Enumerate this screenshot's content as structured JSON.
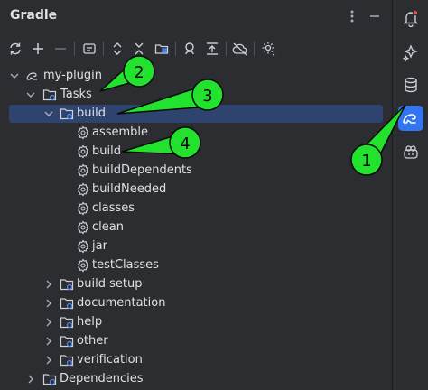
{
  "panel": {
    "title": "Gradle"
  },
  "tree": {
    "root": "my-plugin",
    "tasks": "Tasks",
    "build_group": "build",
    "build_tasks": [
      "assemble",
      "build",
      "buildDependents",
      "buildNeeded",
      "classes",
      "clean",
      "jar",
      "testClasses"
    ],
    "other_groups": [
      "build setup",
      "documentation",
      "help",
      "other",
      "verification"
    ],
    "dependencies": "Dependencies"
  },
  "annotations": [
    "1",
    "2",
    "3",
    "4"
  ],
  "colors": {
    "background": "#2b2d30",
    "selection": "#2e436e",
    "active_tool": "#3574f0",
    "callout_fill": "#22e22e",
    "callout_stroke": "#0a0a0a",
    "notification_dot": "#e5534b"
  },
  "icons": {
    "header": [
      "more-vertical-icon",
      "minimize-icon"
    ],
    "toolbar": [
      "reload-icon",
      "add-icon",
      "remove-icon",
      "execute-task-icon",
      "expand-all-icon",
      "collapse-all-icon",
      "group-modules-icon",
      "analyze-dependencies-icon",
      "toggle-offline-icon",
      "cloud-off-icon",
      "settings-icon"
    ],
    "sidebar": [
      "notifications-icon",
      "ai-assistant-icon",
      "database-icon",
      "gradle-icon",
      "copilot-icon"
    ]
  }
}
